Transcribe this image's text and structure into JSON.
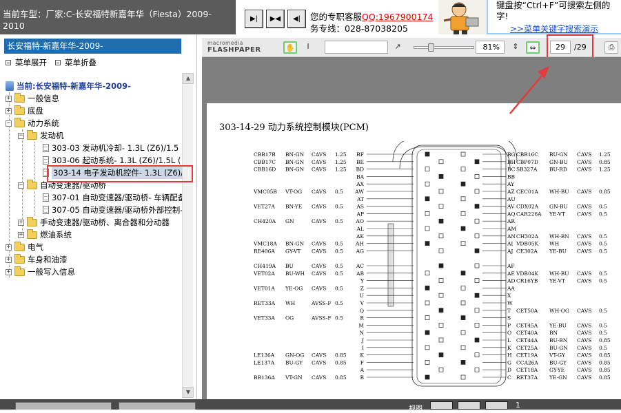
{
  "header": {
    "car_label": "当前车型：厂家:C-长安福特新嘉年华（Fiesta）2009-2010",
    "nav_buttons": [
      "▶|",
      "▶◀",
      "◀|"
    ],
    "service_line1_prefix": "您的专职客服",
    "service_qq": "QQ:1967900174",
    "service_line2": "务专线：028-87038205",
    "hint_text": "键盘按“Ctrl+F”可搜索左侧的字!",
    "hint_link": ">>菜单关键字搜索演示"
  },
  "sidebar": {
    "title": "长安福特-新嘉年华-2009-",
    "expand_label": "菜单展开",
    "collapse_label": "菜单折叠",
    "tree": [
      {
        "label": "当前:长安福特-新嘉年华-2009-",
        "type": "root"
      },
      {
        "label": "一般信息",
        "type": "folder",
        "expanded": false
      },
      {
        "label": "底盘",
        "type": "folder",
        "expanded": false
      },
      {
        "label": "动力系统",
        "type": "folder",
        "expanded": true
      },
      {
        "label": "发动机",
        "type": "folder",
        "expanded": true
      },
      {
        "label": "303-03 发动机冷却- 1.3L (Z6)/1.5",
        "type": "doc"
      },
      {
        "label": "303-06 起动系统- 1.3L (Z6)/1.5L (",
        "type": "doc"
      },
      {
        "label": "303-14 电子发动机控件- 1.3L (Z6)/",
        "type": "doc",
        "selected": true
      },
      {
        "label": "自动变速器/驱动桥",
        "type": "folder",
        "expanded": true
      },
      {
        "label": "307-01 自动变速器/驱动桥- 车辆配备",
        "type": "doc"
      },
      {
        "label": "307-05 自动变速器/驱动桥外部控制-",
        "type": "doc"
      },
      {
        "label": "手动变速器/驱动桥、离合器和分动器",
        "type": "folder",
        "expanded": false
      },
      {
        "label": "燃油系统",
        "type": "folder",
        "expanded": false
      },
      {
        "label": "电气",
        "type": "folder",
        "expanded": false
      },
      {
        "label": "车身和油漆",
        "type": "folder",
        "expanded": false
      },
      {
        "label": "一般写入信息",
        "type": "folder",
        "expanded": false
      }
    ]
  },
  "toolbar": {
    "logo_top": "macromedia",
    "logo_bottom": "FLASHPAPER",
    "search_value": "",
    "zoom": "81%",
    "page_current": "29",
    "page_total": "/29"
  },
  "document": {
    "title": "303-14-29 动力系统控制模块(PCM)",
    "left_rows": [
      {
        "circuit": "CBB17B",
        "color": "BN-GN",
        "type": "CAVS",
        "size": "1.25",
        "pin": "BF"
      },
      {
        "circuit": "CBB17C",
        "color": "BN-GN",
        "type": "CAVS",
        "size": "1.25",
        "pin": "BE"
      },
      {
        "circuit": "CBB16D",
        "color": "BN-GN",
        "type": "CAVS",
        "size": "1.25",
        "pin": "BD"
      },
      {
        "circuit": "",
        "color": "",
        "type": "",
        "size": "",
        "pin": "BA"
      },
      {
        "circuit": "",
        "color": "",
        "type": "",
        "size": "",
        "pin": "AX"
      },
      {
        "circuit": "VMC05B",
        "color": "VT-OG",
        "type": "CAVS",
        "size": "0.5",
        "pin": "AW"
      },
      {
        "circuit": "",
        "color": "",
        "type": "",
        "size": "",
        "pin": "AT"
      },
      {
        "circuit": "VET27A",
        "color": "BN-YE",
        "type": "CAVS",
        "size": "0.5",
        "pin": "AS"
      },
      {
        "circuit": "",
        "color": "",
        "type": "",
        "size": "",
        "pin": "AP"
      },
      {
        "circuit": "CH420A",
        "color": "GN",
        "type": "CAVS",
        "size": "0.5",
        "pin": "AO"
      },
      {
        "circuit": "",
        "color": "",
        "type": "",
        "size": "",
        "pin": "AL"
      },
      {
        "circuit": "",
        "color": "",
        "type": "",
        "size": "",
        "pin": "AK"
      },
      {
        "circuit": "VMC18A",
        "color": "BN-GN",
        "type": "CAVS",
        "size": "0.5",
        "pin": "AH"
      },
      {
        "circuit": "RE406A",
        "color": "GY-VT",
        "type": "CAVS",
        "size": "0.5",
        "pin": "AG"
      },
      {
        "circuit": "",
        "color": "",
        "type": "",
        "size": "",
        "pin": ""
      },
      {
        "circuit": "CH419A",
        "color": "BU",
        "type": "CAVS",
        "size": "0.5",
        "pin": "AC"
      },
      {
        "circuit": "VET02A",
        "color": "BU-WH",
        "type": "CAVS",
        "size": "0.5",
        "pin": "AB"
      },
      {
        "circuit": "",
        "color": "",
        "type": "",
        "size": "",
        "pin": "Y"
      },
      {
        "circuit": "VET01A",
        "color": "YE-OG",
        "type": "CAVS",
        "size": "0.5",
        "pin": "Z"
      },
      {
        "circuit": "",
        "color": "",
        "type": "",
        "size": "",
        "pin": "U"
      },
      {
        "circuit": "RET33A",
        "color": "WH",
        "type": "AVSS-F",
        "size": "0.5",
        "pin": "V"
      },
      {
        "circuit": "",
        "color": "",
        "type": "",
        "size": "",
        "pin": "Q"
      },
      {
        "circuit": "VET33A",
        "color": "OG",
        "type": "AVSS-F",
        "size": "0.5",
        "pin": "R"
      },
      {
        "circuit": "",
        "color": "",
        "type": "",
        "size": "",
        "pin": "M"
      },
      {
        "circuit": "",
        "color": "",
        "type": "",
        "size": "",
        "pin": "N"
      },
      {
        "circuit": "",
        "color": "",
        "type": "",
        "size": "",
        "pin": "J"
      },
      {
        "circuit": "",
        "color": "",
        "type": "",
        "size": "",
        "pin": "I"
      },
      {
        "circuit": "LE136A",
        "color": "GN-OG",
        "type": "CAVS",
        "size": "0.85",
        "pin": "K"
      },
      {
        "circuit": "LE137A",
        "color": "BU-GY",
        "type": "CAVS",
        "size": "0.85",
        "pin": "F"
      },
      {
        "circuit": "",
        "color": "",
        "type": "",
        "size": "",
        "pin": "A"
      },
      {
        "circuit": "BB136A",
        "color": "VT-GN",
        "type": "CAVS",
        "size": "0.85",
        "pin": "B"
      }
    ],
    "right_rows": [
      {
        "pin": "BG",
        "circuit": "CBB16C",
        "color": "BU-GN",
        "type": "CAVS",
        "size": "1.25"
      },
      {
        "pin": "BH",
        "circuit": "CBP07D",
        "color": "GN-BU",
        "type": "CAVS",
        "size": "0.85"
      },
      {
        "pin": "BC",
        "circuit": "SB327A",
        "color": "BU-RD",
        "type": "CAVS",
        "size": "1.25"
      },
      {
        "pin": "BB",
        "circuit": "",
        "color": "",
        "type": "",
        "size": ""
      },
      {
        "pin": "AY",
        "circuit": "",
        "color": "",
        "type": "",
        "size": ""
      },
      {
        "pin": "AZ",
        "circuit": "CEC01A",
        "color": "WH-BU",
        "type": "CAVS",
        "size": "0.85"
      },
      {
        "pin": "AU",
        "circuit": "",
        "color": "",
        "type": "",
        "size": ""
      },
      {
        "pin": "AV",
        "circuit": "CDX02A",
        "color": "GN-BU",
        "type": "CAVS",
        "size": "0.5"
      },
      {
        "pin": "AQ",
        "circuit": "CAR226A",
        "color": "YE-VT",
        "type": "CAVS",
        "size": "0.5"
      },
      {
        "pin": "AR",
        "circuit": "",
        "color": "",
        "type": "",
        "size": ""
      },
      {
        "pin": "AM",
        "circuit": "",
        "color": "",
        "type": "",
        "size": ""
      },
      {
        "pin": "AN",
        "circuit": "CH302A",
        "color": "WH-BN",
        "type": "CAVS",
        "size": "0.5"
      },
      {
        "pin": "AI",
        "circuit": "VDB05K",
        "color": "WH",
        "type": "CAVS",
        "size": "0.5"
      },
      {
        "pin": "AJ",
        "circuit": "CE302A",
        "color": "YE-BU",
        "type": "CAVS",
        "size": "0.5"
      },
      {
        "pin": "",
        "circuit": "",
        "color": "",
        "type": "",
        "size": ""
      },
      {
        "pin": "AF",
        "circuit": "",
        "color": "",
        "type": "",
        "size": ""
      },
      {
        "pin": "AE",
        "circuit": "VDB04K",
        "color": "WH-BU",
        "type": "CAVS",
        "size": "0.5"
      },
      {
        "pin": "AD",
        "circuit": "CR16YB",
        "color": "YE-VT",
        "type": "CAVS",
        "size": "0.5"
      },
      {
        "pin": "AA",
        "circuit": "",
        "color": "",
        "type": "",
        "size": ""
      },
      {
        "pin": "X",
        "circuit": "",
        "color": "",
        "type": "",
        "size": ""
      },
      {
        "pin": "W",
        "circuit": "",
        "color": "",
        "type": "",
        "size": ""
      },
      {
        "pin": "T",
        "circuit": "CET50A",
        "color": "WH-OG",
        "type": "CAVS",
        "size": "0.5"
      },
      {
        "pin": "S",
        "circuit": "",
        "color": "",
        "type": "",
        "size": ""
      },
      {
        "pin": "P",
        "circuit": "CET45A",
        "color": "YE-BU",
        "type": "CAVS",
        "size": "0.5"
      },
      {
        "pin": "O",
        "circuit": "CET40A",
        "color": "BN",
        "type": "CAVS",
        "size": "0.5"
      },
      {
        "pin": "L",
        "circuit": "CET44A",
        "color": "BU-BN",
        "type": "CAVS",
        "size": "0.85"
      },
      {
        "pin": "K",
        "circuit": "CET25A",
        "color": "BU-GN",
        "type": "CAVS",
        "size": "0.5"
      },
      {
        "pin": "H",
        "circuit": "CET19A",
        "color": "VT-GY",
        "type": "CAVS",
        "size": "0.85"
      },
      {
        "pin": "G",
        "circuit": "CCA26A",
        "color": "BU-GY",
        "type": "CAVS",
        "size": "0.85"
      },
      {
        "pin": "D",
        "circuit": "CET18A",
        "color": "GY-YE",
        "type": "CAVS",
        "size": "0.85"
      },
      {
        "pin": "C",
        "circuit": "RET37A",
        "color": "YE-GN",
        "type": "CAVS",
        "size": "0.85"
      }
    ]
  },
  "bottombar": {
    "view_label": "视图",
    "page_number": "1"
  },
  "colors": {
    "header_bg": "#5b5b5b",
    "sidebar_title_bg": "#1f6dae",
    "highlight_red": "#e23b3b",
    "doc_bg": "#7f7f7f",
    "link_blue": "#1a4fd0"
  }
}
